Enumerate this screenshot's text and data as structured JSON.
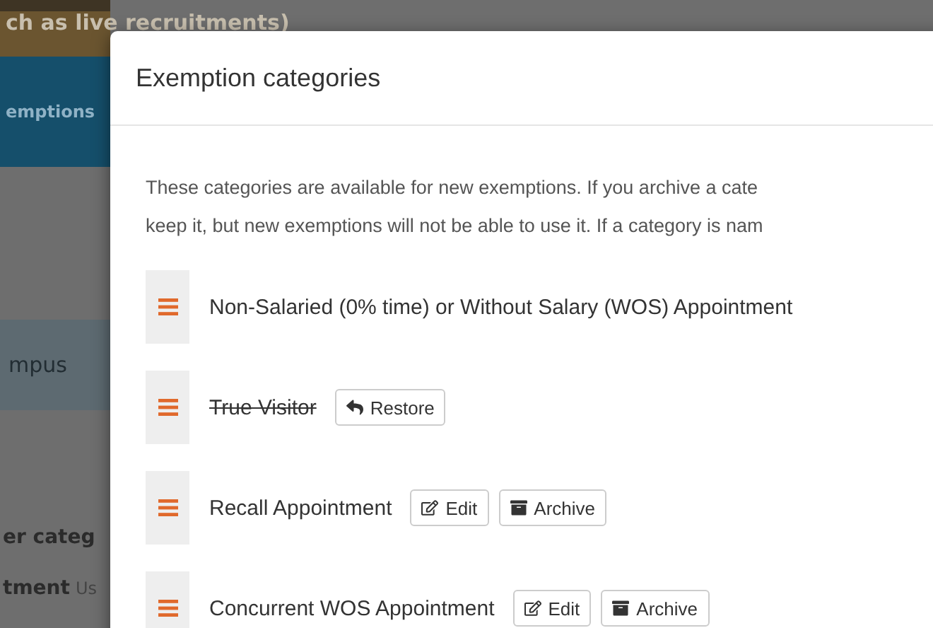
{
  "background": {
    "banner_text": "ch as live recruitments)",
    "nav_tab": "emptions",
    "highlighted_item": "mpus",
    "lines": [
      "er categ",
      "tment"
    ],
    "line_suffix": "Us"
  },
  "modal": {
    "title": "Exemption categories",
    "description_lines": [
      "These categories are available for new exemptions. If you archive a cate",
      "keep it, but new exemptions will not be able to use it. If a category is nam"
    ],
    "categories": [
      {
        "name": "Non-Salaried (0% time) or Without Salary (WOS) Appointment",
        "archived": false
      },
      {
        "name": "True Visitor",
        "archived": true,
        "actions": [
          {
            "kind": "restore",
            "label": "Restore"
          }
        ]
      },
      {
        "name": "Recall Appointment",
        "archived": false,
        "actions": [
          {
            "kind": "edit",
            "label": "Edit"
          },
          {
            "kind": "archive",
            "label": "Archive"
          }
        ]
      },
      {
        "name": "Concurrent WOS Appointment",
        "archived": false,
        "actions": [
          {
            "kind": "edit",
            "label": "Edit"
          },
          {
            "kind": "archive",
            "label": "Archive"
          }
        ]
      }
    ]
  }
}
